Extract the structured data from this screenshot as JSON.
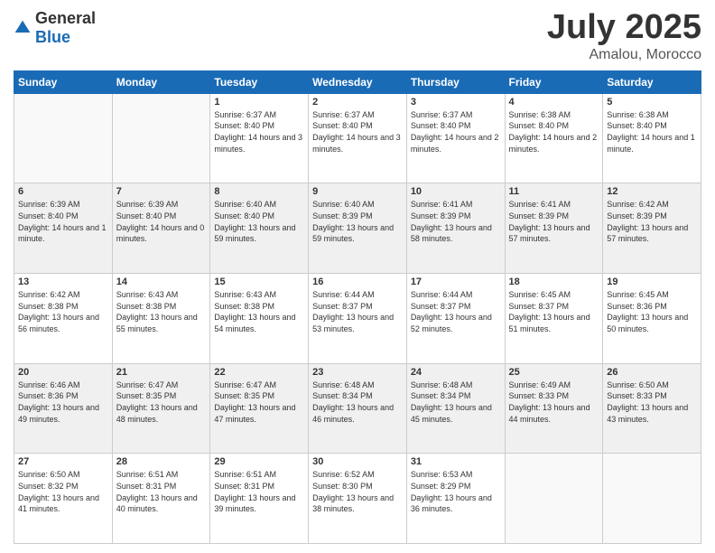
{
  "header": {
    "logo": {
      "general": "General",
      "blue": "Blue"
    },
    "title": "July 2025",
    "location": "Amalou, Morocco"
  },
  "weekdays": [
    "Sunday",
    "Monday",
    "Tuesday",
    "Wednesday",
    "Thursday",
    "Friday",
    "Saturday"
  ],
  "weeks": [
    [
      {
        "day": "",
        "info": ""
      },
      {
        "day": "",
        "info": ""
      },
      {
        "day": "1",
        "info": "Sunrise: 6:37 AM\nSunset: 8:40 PM\nDaylight: 14 hours and 3 minutes."
      },
      {
        "day": "2",
        "info": "Sunrise: 6:37 AM\nSunset: 8:40 PM\nDaylight: 14 hours and 3 minutes."
      },
      {
        "day": "3",
        "info": "Sunrise: 6:37 AM\nSunset: 8:40 PM\nDaylight: 14 hours and 2 minutes."
      },
      {
        "day": "4",
        "info": "Sunrise: 6:38 AM\nSunset: 8:40 PM\nDaylight: 14 hours and 2 minutes."
      },
      {
        "day": "5",
        "info": "Sunrise: 6:38 AM\nSunset: 8:40 PM\nDaylight: 14 hours and 1 minute."
      }
    ],
    [
      {
        "day": "6",
        "info": "Sunrise: 6:39 AM\nSunset: 8:40 PM\nDaylight: 14 hours and 1 minute."
      },
      {
        "day": "7",
        "info": "Sunrise: 6:39 AM\nSunset: 8:40 PM\nDaylight: 14 hours and 0 minutes."
      },
      {
        "day": "8",
        "info": "Sunrise: 6:40 AM\nSunset: 8:40 PM\nDaylight: 13 hours and 59 minutes."
      },
      {
        "day": "9",
        "info": "Sunrise: 6:40 AM\nSunset: 8:39 PM\nDaylight: 13 hours and 59 minutes."
      },
      {
        "day": "10",
        "info": "Sunrise: 6:41 AM\nSunset: 8:39 PM\nDaylight: 13 hours and 58 minutes."
      },
      {
        "day": "11",
        "info": "Sunrise: 6:41 AM\nSunset: 8:39 PM\nDaylight: 13 hours and 57 minutes."
      },
      {
        "day": "12",
        "info": "Sunrise: 6:42 AM\nSunset: 8:39 PM\nDaylight: 13 hours and 57 minutes."
      }
    ],
    [
      {
        "day": "13",
        "info": "Sunrise: 6:42 AM\nSunset: 8:38 PM\nDaylight: 13 hours and 56 minutes."
      },
      {
        "day": "14",
        "info": "Sunrise: 6:43 AM\nSunset: 8:38 PM\nDaylight: 13 hours and 55 minutes."
      },
      {
        "day": "15",
        "info": "Sunrise: 6:43 AM\nSunset: 8:38 PM\nDaylight: 13 hours and 54 minutes."
      },
      {
        "day": "16",
        "info": "Sunrise: 6:44 AM\nSunset: 8:37 PM\nDaylight: 13 hours and 53 minutes."
      },
      {
        "day": "17",
        "info": "Sunrise: 6:44 AM\nSunset: 8:37 PM\nDaylight: 13 hours and 52 minutes."
      },
      {
        "day": "18",
        "info": "Sunrise: 6:45 AM\nSunset: 8:37 PM\nDaylight: 13 hours and 51 minutes."
      },
      {
        "day": "19",
        "info": "Sunrise: 6:45 AM\nSunset: 8:36 PM\nDaylight: 13 hours and 50 minutes."
      }
    ],
    [
      {
        "day": "20",
        "info": "Sunrise: 6:46 AM\nSunset: 8:36 PM\nDaylight: 13 hours and 49 minutes."
      },
      {
        "day": "21",
        "info": "Sunrise: 6:47 AM\nSunset: 8:35 PM\nDaylight: 13 hours and 48 minutes."
      },
      {
        "day": "22",
        "info": "Sunrise: 6:47 AM\nSunset: 8:35 PM\nDaylight: 13 hours and 47 minutes."
      },
      {
        "day": "23",
        "info": "Sunrise: 6:48 AM\nSunset: 8:34 PM\nDaylight: 13 hours and 46 minutes."
      },
      {
        "day": "24",
        "info": "Sunrise: 6:48 AM\nSunset: 8:34 PM\nDaylight: 13 hours and 45 minutes."
      },
      {
        "day": "25",
        "info": "Sunrise: 6:49 AM\nSunset: 8:33 PM\nDaylight: 13 hours and 44 minutes."
      },
      {
        "day": "26",
        "info": "Sunrise: 6:50 AM\nSunset: 8:33 PM\nDaylight: 13 hours and 43 minutes."
      }
    ],
    [
      {
        "day": "27",
        "info": "Sunrise: 6:50 AM\nSunset: 8:32 PM\nDaylight: 13 hours and 41 minutes."
      },
      {
        "day": "28",
        "info": "Sunrise: 6:51 AM\nSunset: 8:31 PM\nDaylight: 13 hours and 40 minutes."
      },
      {
        "day": "29",
        "info": "Sunrise: 6:51 AM\nSunset: 8:31 PM\nDaylight: 13 hours and 39 minutes."
      },
      {
        "day": "30",
        "info": "Sunrise: 6:52 AM\nSunset: 8:30 PM\nDaylight: 13 hours and 38 minutes."
      },
      {
        "day": "31",
        "info": "Sunrise: 6:53 AM\nSunset: 8:29 PM\nDaylight: 13 hours and 36 minutes."
      },
      {
        "day": "",
        "info": ""
      },
      {
        "day": "",
        "info": ""
      }
    ]
  ]
}
